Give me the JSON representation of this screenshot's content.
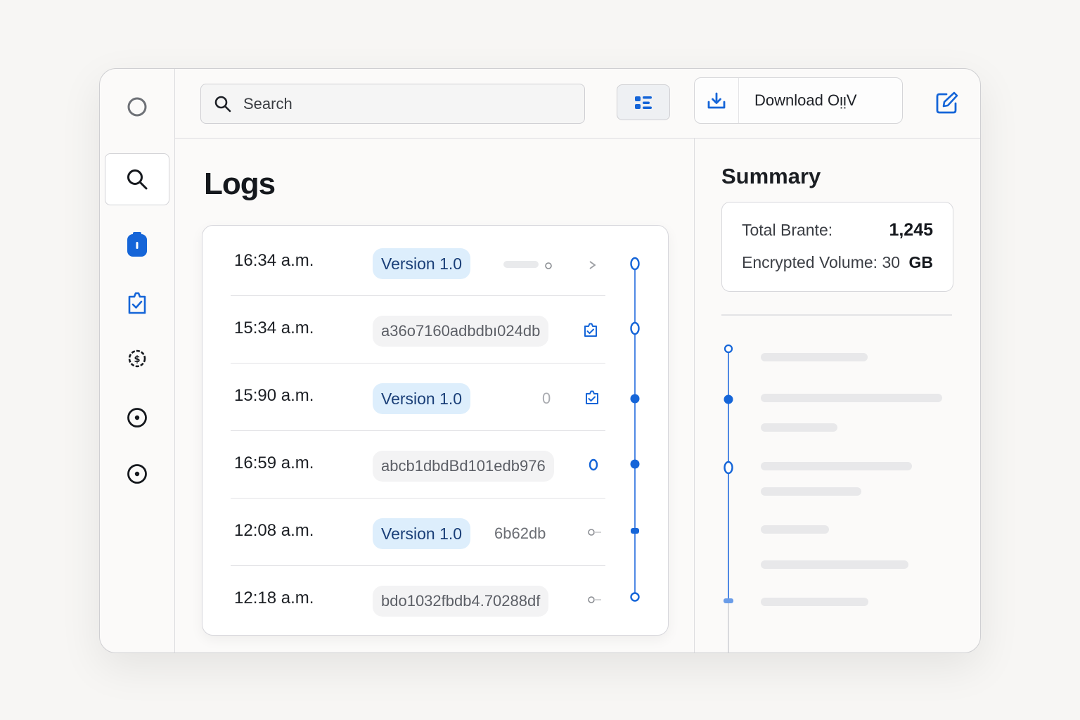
{
  "search": {
    "placeholder": "Search"
  },
  "toolbar": {
    "download_label": "Download OᴉᴉV"
  },
  "main": {
    "title": "Logs"
  },
  "logs": [
    {
      "time": "16:34 a.m.",
      "pill": "Version 1.0",
      "pill_kind": "version",
      "extra": ""
    },
    {
      "time": "15:34 a.m.",
      "pill": "a36o7160adbdbı024db",
      "pill_kind": "hash",
      "extra": ""
    },
    {
      "time": "15:90 a.m.",
      "pill": "Version 1.0",
      "pill_kind": "version",
      "extra": "0"
    },
    {
      "time": "16:59 a.m.",
      "pill": "abcb1dbdBd101edb976",
      "pill_kind": "hash",
      "extra": ""
    },
    {
      "time": "12:08 a.m.",
      "pill": "Version 1.0",
      "pill_kind": "version",
      "extra": "6b62db"
    },
    {
      "time": "12:18 a.m.",
      "pill": "bdo1032fbdb4.70288df",
      "pill_kind": "hash",
      "extra": ""
    }
  ],
  "summary": {
    "title": "Summary",
    "total_label": "Total Brante:",
    "total_value": "1,245",
    "volume_label": "Encrypted Volume: 30",
    "volume_unit": "GB"
  },
  "icons": {
    "sidebar": [
      "circle-icon",
      "search-icon",
      "lock-icon",
      "shield-check-icon",
      "dollar-icon",
      "target-icon",
      "target-icon"
    ],
    "toolbar": [
      "search-icon",
      "filter-icon",
      "download-icon",
      "edit-icon"
    ]
  },
  "colors": {
    "accent": "#1565d8",
    "pill_bg": "#ddeefc",
    "timeline": "#4f88e4"
  }
}
